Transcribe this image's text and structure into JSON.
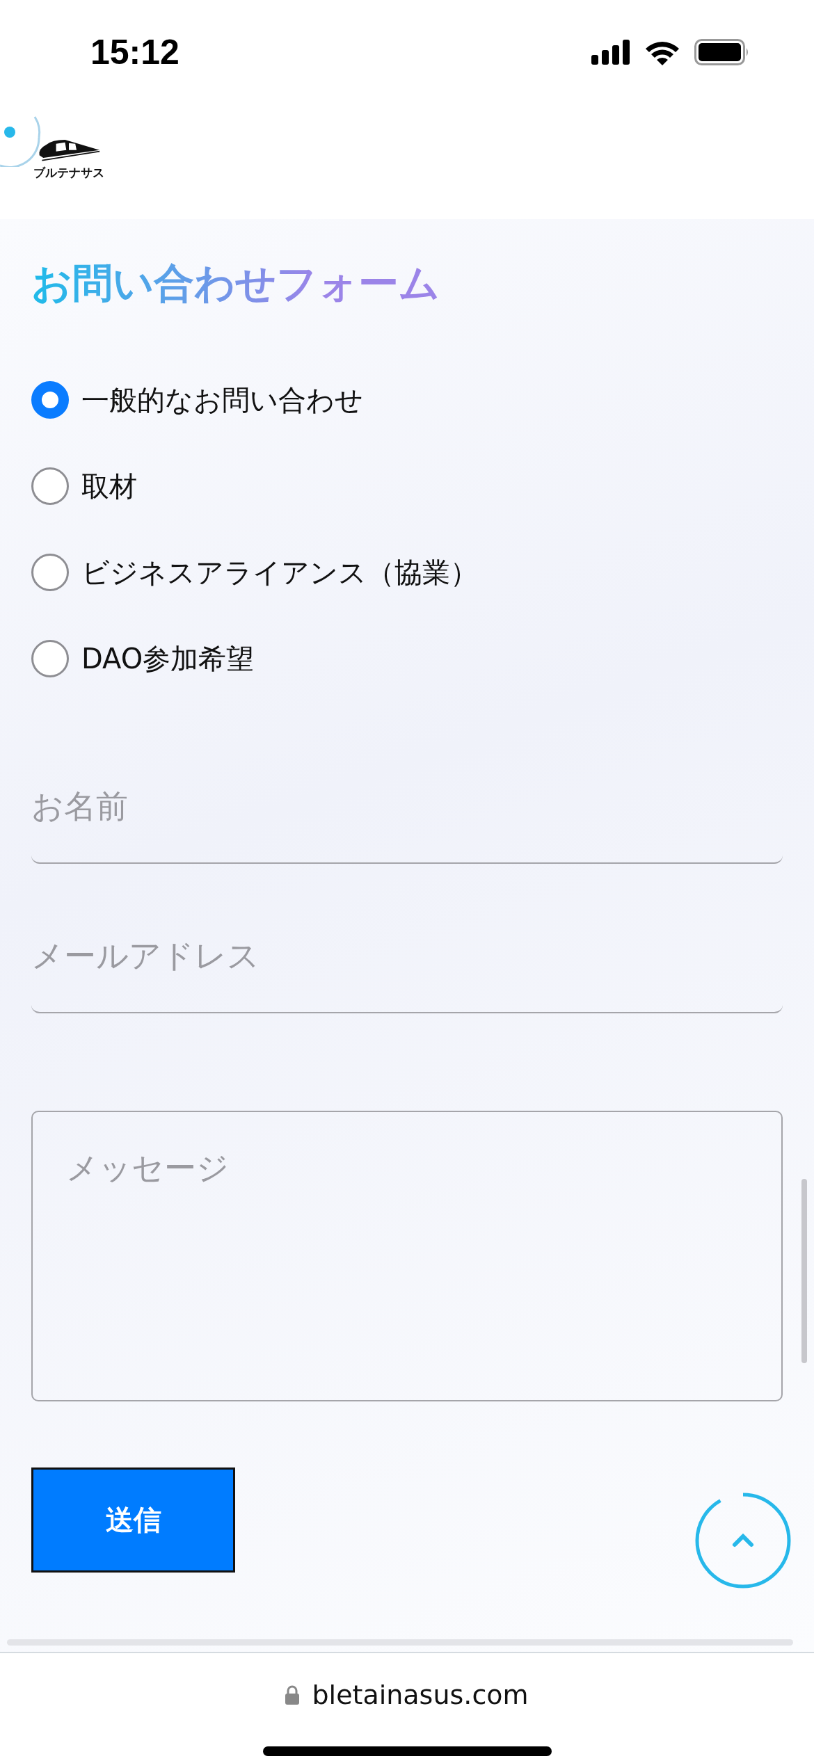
{
  "status_bar": {
    "time": "15:12"
  },
  "header": {
    "logo_text": "ブルテナサス"
  },
  "form": {
    "title": "お問い合わせフォーム",
    "inquiry_types": [
      {
        "label": "一般的なお問い合わせ",
        "selected": true
      },
      {
        "label": "取材",
        "selected": false
      },
      {
        "label": "ビジネスアライアンス（協業）",
        "selected": false
      },
      {
        "label": "DAO参加希望",
        "selected": false
      }
    ],
    "fields": [
      {
        "kind": "line",
        "placeholder": "お名前"
      },
      {
        "kind": "line",
        "placeholder": "メールアドレス"
      },
      {
        "kind": "area",
        "placeholder": "メッセージ"
      }
    ],
    "submit": "送信"
  },
  "browser": {
    "url": "bletainasus.com"
  }
}
